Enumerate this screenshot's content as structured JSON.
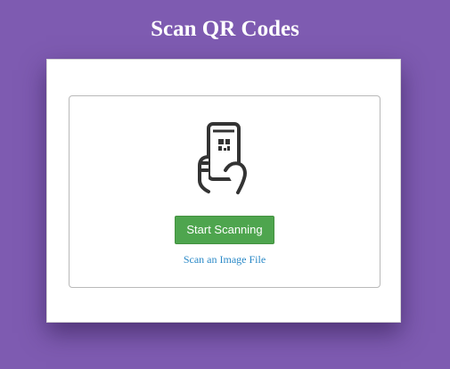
{
  "header": {
    "title": "Scan QR Codes"
  },
  "scanner": {
    "icon": "phone-qr-scan-icon",
    "start_button_label": "Start Scanning",
    "file_link_label": "Scan an Image File"
  },
  "colors": {
    "background": "#7e5bb1",
    "button": "#4ea54e",
    "link": "#2a89c7"
  }
}
